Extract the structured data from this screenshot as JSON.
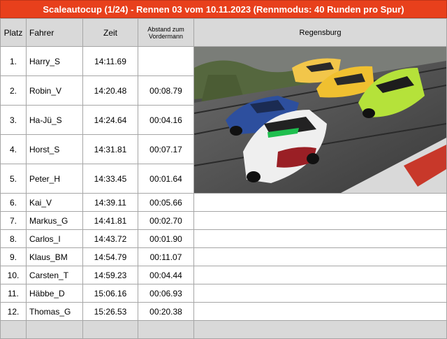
{
  "title": "Scaleautocup (1/24) -  Rennen 03 vom 10.11.2023 (Rennmodus: 40 Runden pro Spur)",
  "headers": {
    "platz": "Platz",
    "fahrer": "Fahrer",
    "zeit": "Zeit",
    "abstand_line1": "Abstand zum",
    "abstand_line2": "Vordermann",
    "location": "Regensburg"
  },
  "rows": [
    {
      "platz": "1.",
      "fahrer": "Harry_S",
      "zeit": "14:11.69",
      "abstand": ""
    },
    {
      "platz": "2.",
      "fahrer": "Robin_V",
      "zeit": "14:20.48",
      "abstand": "00:08.79"
    },
    {
      "platz": "3.",
      "fahrer": "Ha-Jü_S",
      "zeit": "14:24.64",
      "abstand": "00:04.16"
    },
    {
      "platz": "4.",
      "fahrer": "Horst_S",
      "zeit": "14:31.81",
      "abstand": "00:07.17"
    },
    {
      "platz": "5.",
      "fahrer": "Peter_H",
      "zeit": "14:33.45",
      "abstand": "00:01.64"
    },
    {
      "platz": "6.",
      "fahrer": "Kai_V",
      "zeit": "14:39.11",
      "abstand": "00:05.66"
    },
    {
      "platz": "7.",
      "fahrer": "Markus_G",
      "zeit": "14:41.81",
      "abstand": "00:02.70"
    },
    {
      "platz": "8.",
      "fahrer": "Carlos_I",
      "zeit": "14:43.72",
      "abstand": "00:01.90"
    },
    {
      "platz": "9.",
      "fahrer": "Klaus_BM",
      "zeit": "14:54.79",
      "abstand": "00:11.07"
    },
    {
      "platz": "10.",
      "fahrer": "Carsten_T",
      "zeit": "14:59.23",
      "abstand": "00:04.44"
    },
    {
      "platz": "11.",
      "fahrer": "Häbbe_D",
      "zeit": "15:06.16",
      "abstand": "00:06.93"
    },
    {
      "platz": "12.",
      "fahrer": "Thomas_G",
      "zeit": "15:26.53",
      "abstand": "00:20.38"
    }
  ],
  "colors": {
    "title_bg": "#e8401c",
    "header_bg": "#d9d9d9",
    "grid": "#a6a6a6"
  }
}
